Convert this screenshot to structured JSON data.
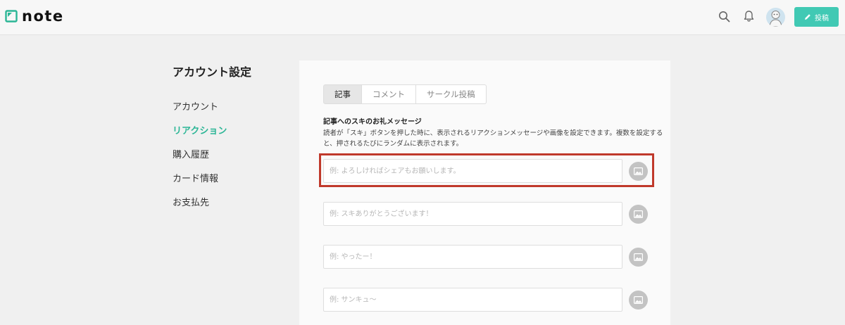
{
  "header": {
    "logo_text": "note",
    "post_label": "投稿",
    "icons": {
      "search": "search-icon",
      "bell": "bell-icon",
      "pen": "pen-icon"
    }
  },
  "sidebar": {
    "title": "アカウント設定",
    "items": [
      {
        "label": "アカウント",
        "active": false
      },
      {
        "label": "リアクション",
        "active": true
      },
      {
        "label": "購入履歴",
        "active": false
      },
      {
        "label": "カード情報",
        "active": false
      },
      {
        "label": "お支払先",
        "active": false
      }
    ]
  },
  "main": {
    "tabs": [
      {
        "label": "記事",
        "active": true
      },
      {
        "label": "コメント",
        "active": false
      },
      {
        "label": "サークル投稿",
        "active": false
      }
    ],
    "section_title": "記事へのスキのお礼メッセージ",
    "description": "読者が「スキ」ボタンを押した時に、表示されるリアクションメッセージや画像を設定できます。複数を設定すると、押されるたびにランダムに表示されます。",
    "messages": [
      {
        "placeholder": "例: よろしければシェアもお願いします。",
        "value": ""
      },
      {
        "placeholder": "例: スキありがとうございます！",
        "value": ""
      },
      {
        "placeholder": "例: やったー！",
        "value": ""
      },
      {
        "placeholder": "例: サンキュ〜",
        "value": ""
      }
    ]
  },
  "colors": {
    "accent": "#2cb696",
    "post_button": "#41c9b4",
    "highlight": "#c0392b"
  }
}
